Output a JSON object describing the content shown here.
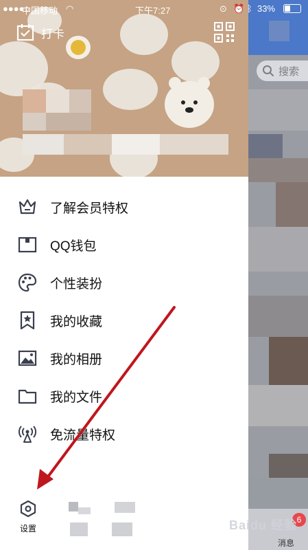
{
  "status_bar": {
    "carrier": "中国移动",
    "time": "下午7:27",
    "battery": "33%"
  },
  "header": {
    "clock_in_label": "打卡"
  },
  "menu": {
    "items": [
      {
        "icon": "crown-icon",
        "label": "了解会员特权"
      },
      {
        "icon": "wallet-icon",
        "label": "QQ钱包"
      },
      {
        "icon": "palette-icon",
        "label": "个性装扮"
      },
      {
        "icon": "bookmark-star-icon",
        "label": "我的收藏"
      },
      {
        "icon": "image-icon",
        "label": "我的相册"
      },
      {
        "icon": "folder-icon",
        "label": "我的文件"
      },
      {
        "icon": "antenna-icon",
        "label": "免流量特权"
      }
    ]
  },
  "bottom": {
    "settings_label": "设置"
  },
  "background_screen": {
    "search_placeholder": "搜索",
    "tab_messages": "消息",
    "messages_badge": "6"
  },
  "watermark": "Baidu 经验",
  "colors": {
    "header_bg": "#c5a384",
    "annotation_arrow": "#c0161e",
    "badge": "#e5484d"
  }
}
